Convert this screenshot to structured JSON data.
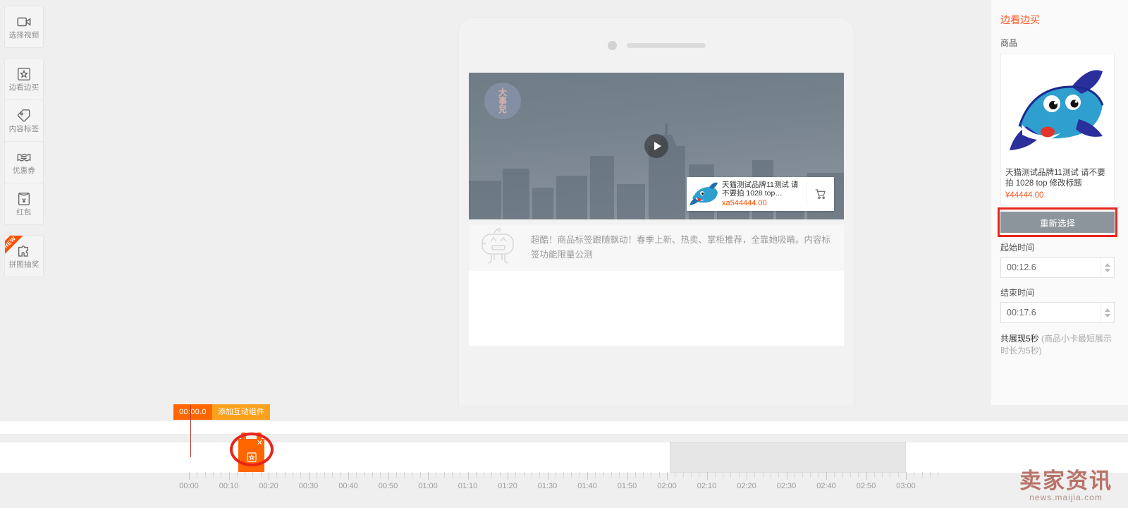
{
  "sidebar": {
    "groups": [
      {
        "items": [
          {
            "label": "选择视频",
            "icon": "video-camera-icon",
            "new": false
          }
        ]
      },
      {
        "items": [
          {
            "label": "边看边买",
            "icon": "star-box-icon",
            "new": false
          },
          {
            "label": "内容标签",
            "icon": "price-tag-icon",
            "new": false
          },
          {
            "label": "优惠券",
            "icon": "coupon-icon",
            "new": false
          },
          {
            "label": "红包",
            "icon": "red-packet-icon",
            "new": false
          }
        ]
      },
      {
        "items": [
          {
            "label": "拼图抽奖",
            "icon": "puzzle-icon",
            "new": true,
            "new_label": "NEW"
          }
        ]
      }
    ]
  },
  "preview": {
    "video_watermark": "大事兒",
    "play_label": "播放",
    "overlay_card": {
      "title": "天猫测试品牌11测试 请不要拍 1028 top…",
      "price": "xa544444.00",
      "cart_icon": "shopping-cart-icon"
    },
    "caption": "超酷！商品标签跟随飘动！春季上新、热卖、掌柜推荐，全靠她吸睛。内容标签功能限量公测"
  },
  "panel": {
    "title": "边看边买",
    "product_section_label": "商品",
    "product": {
      "title": "天猫测试品牌11测试 请不要拍 1028 top 修改标题",
      "price": "¥44444.00",
      "image_alt": "dolphin-product-image"
    },
    "reselect_label": "重新选择",
    "start_time_label": "起始时间",
    "start_time_value": "00:12.6",
    "end_time_label": "结束时间",
    "end_time_value": "00:17.6",
    "duration_text": "共展现5秒",
    "duration_note": "(商品小卡最短展示时长为5秒)",
    "highlight_color": "#e8251c",
    "accent_color": "#ff5722"
  },
  "timeline": {
    "current_time": "00:00.0",
    "add_component_label": "添加互动组件",
    "marker_icon": "star-box-icon",
    "marker_close_icon": "close-icon",
    "ruler_labels": [
      "00:00",
      "00:10",
      "00:20",
      "00:30",
      "00:40",
      "00:50",
      "01:00",
      "01:10",
      "01:20",
      "01:30",
      "01:40",
      "01:50",
      "02:00",
      "02:10",
      "02:20",
      "02:30",
      "02:40",
      "02:50",
      "03:00"
    ]
  },
  "watermark": {
    "cn": "卖家资讯",
    "en": "news.maijia.com"
  }
}
